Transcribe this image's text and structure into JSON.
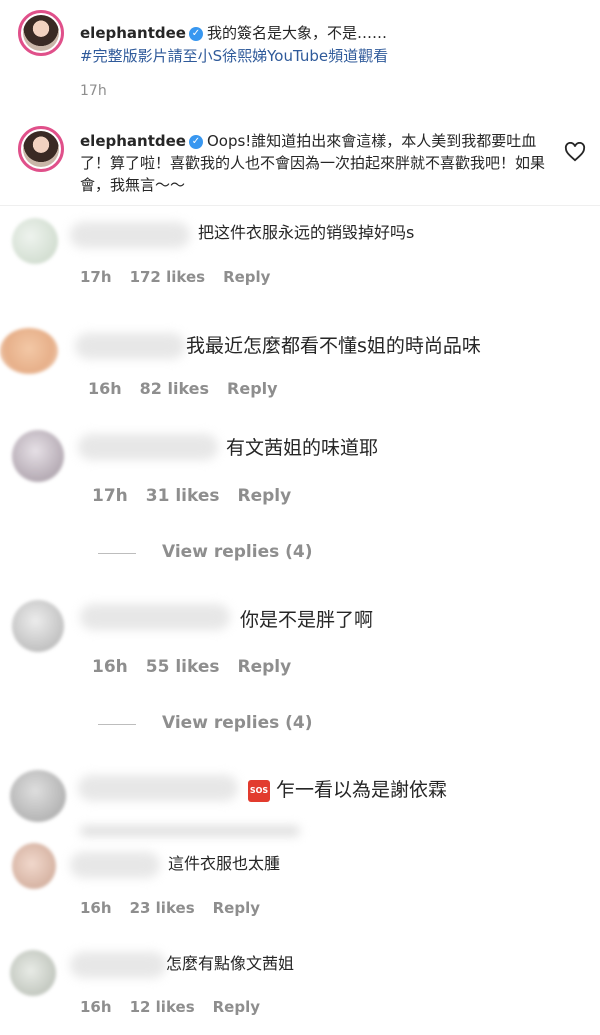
{
  "post": {
    "caption": {
      "username": "elephantdee",
      "text": "我的簽名是大象，不是……",
      "hashtag": "#完整版影片請至小S徐熙娣YouTube頻道觀看",
      "time": "17h"
    },
    "reply": {
      "username": "elephantdee",
      "text": "Oops!誰知道拍出來會這樣，本人美到我都要吐血了！算了啦！喜歡我的人也不會因為一次拍起來胖就不喜歡我吧！如果會，我無言～～"
    }
  },
  "comments": [
    {
      "text": "把这件衣服永远的销毁掉好吗s",
      "time": "17h",
      "likes": "172 likes",
      "reply": "Reply"
    },
    {
      "text": "我最近怎麼都看不懂s姐的時尚品味",
      "time": "16h",
      "likes": "82 likes",
      "reply": "Reply"
    },
    {
      "text": "有文茜姐的味道耶",
      "time": "17h",
      "likes": "31 likes",
      "reply": "Reply",
      "view_replies": "View replies (4)"
    },
    {
      "text": "你是不是胖了啊",
      "time": "16h",
      "likes": "55 likes",
      "reply": "Reply",
      "view_replies": "View replies (4)"
    },
    {
      "text": "乍一看以為是謝依霖",
      "sos": "SOS"
    },
    {
      "text": "這件衣服也太腫",
      "time": "16h",
      "likes": "23 likes",
      "reply": "Reply"
    },
    {
      "text": "怎麼有點像文茜姐",
      "time": "16h",
      "likes": "12 likes",
      "reply": "Reply"
    }
  ],
  "icons": {
    "verified": "verified-badge-icon",
    "like": "heart-icon",
    "sos": "sos-emoji-icon"
  },
  "colors": {
    "ring": "#e0508a",
    "hashtag": "#2f5a9a",
    "verified": "#3897f0",
    "meta": "#8e8e8e"
  }
}
